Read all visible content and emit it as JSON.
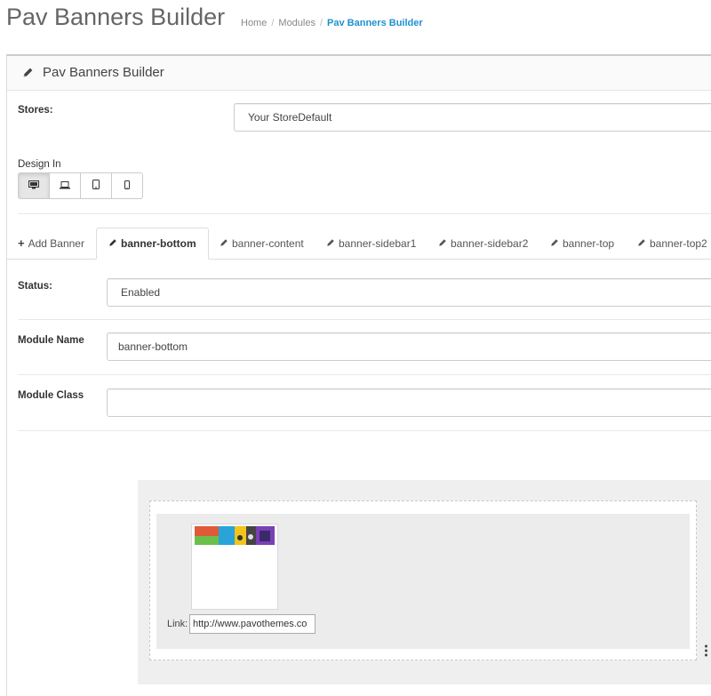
{
  "header": {
    "title": "Pav Banners Builder",
    "breadcrumb": {
      "home": "Home",
      "sep": "/",
      "modules": "Modules",
      "current": "Pav Banners Builder"
    }
  },
  "panel": {
    "title": "Pav Banners Builder"
  },
  "stores": {
    "label": "Stores:",
    "value": "Your StoreDefault"
  },
  "design": {
    "label": "Design In",
    "devices": [
      "desktop-icon",
      "laptop-icon",
      "tablet-icon",
      "phone-icon"
    ]
  },
  "tabs": {
    "add": "Add Banner",
    "items": [
      "banner-bottom",
      "banner-content",
      "banner-sidebar1",
      "banner-sidebar2",
      "banner-top",
      "banner-top2"
    ],
    "active_index": 0
  },
  "form": {
    "status_label": "Status:",
    "status_value": "Enabled",
    "module_name_label": "Module Name",
    "module_name_value": "banner-bottom",
    "module_class_label": "Module Class",
    "module_class_value": ""
  },
  "builder": {
    "link_label": "Link:",
    "link_value": "http://www.pavothemes.co"
  },
  "colors": {
    "accent": "#1e91cf",
    "thumb_colors": [
      "#e05a3a",
      "#6bbf4a",
      "#2aa4d8",
      "#f2c41c",
      "#444444",
      "#7a3fb5"
    ]
  }
}
